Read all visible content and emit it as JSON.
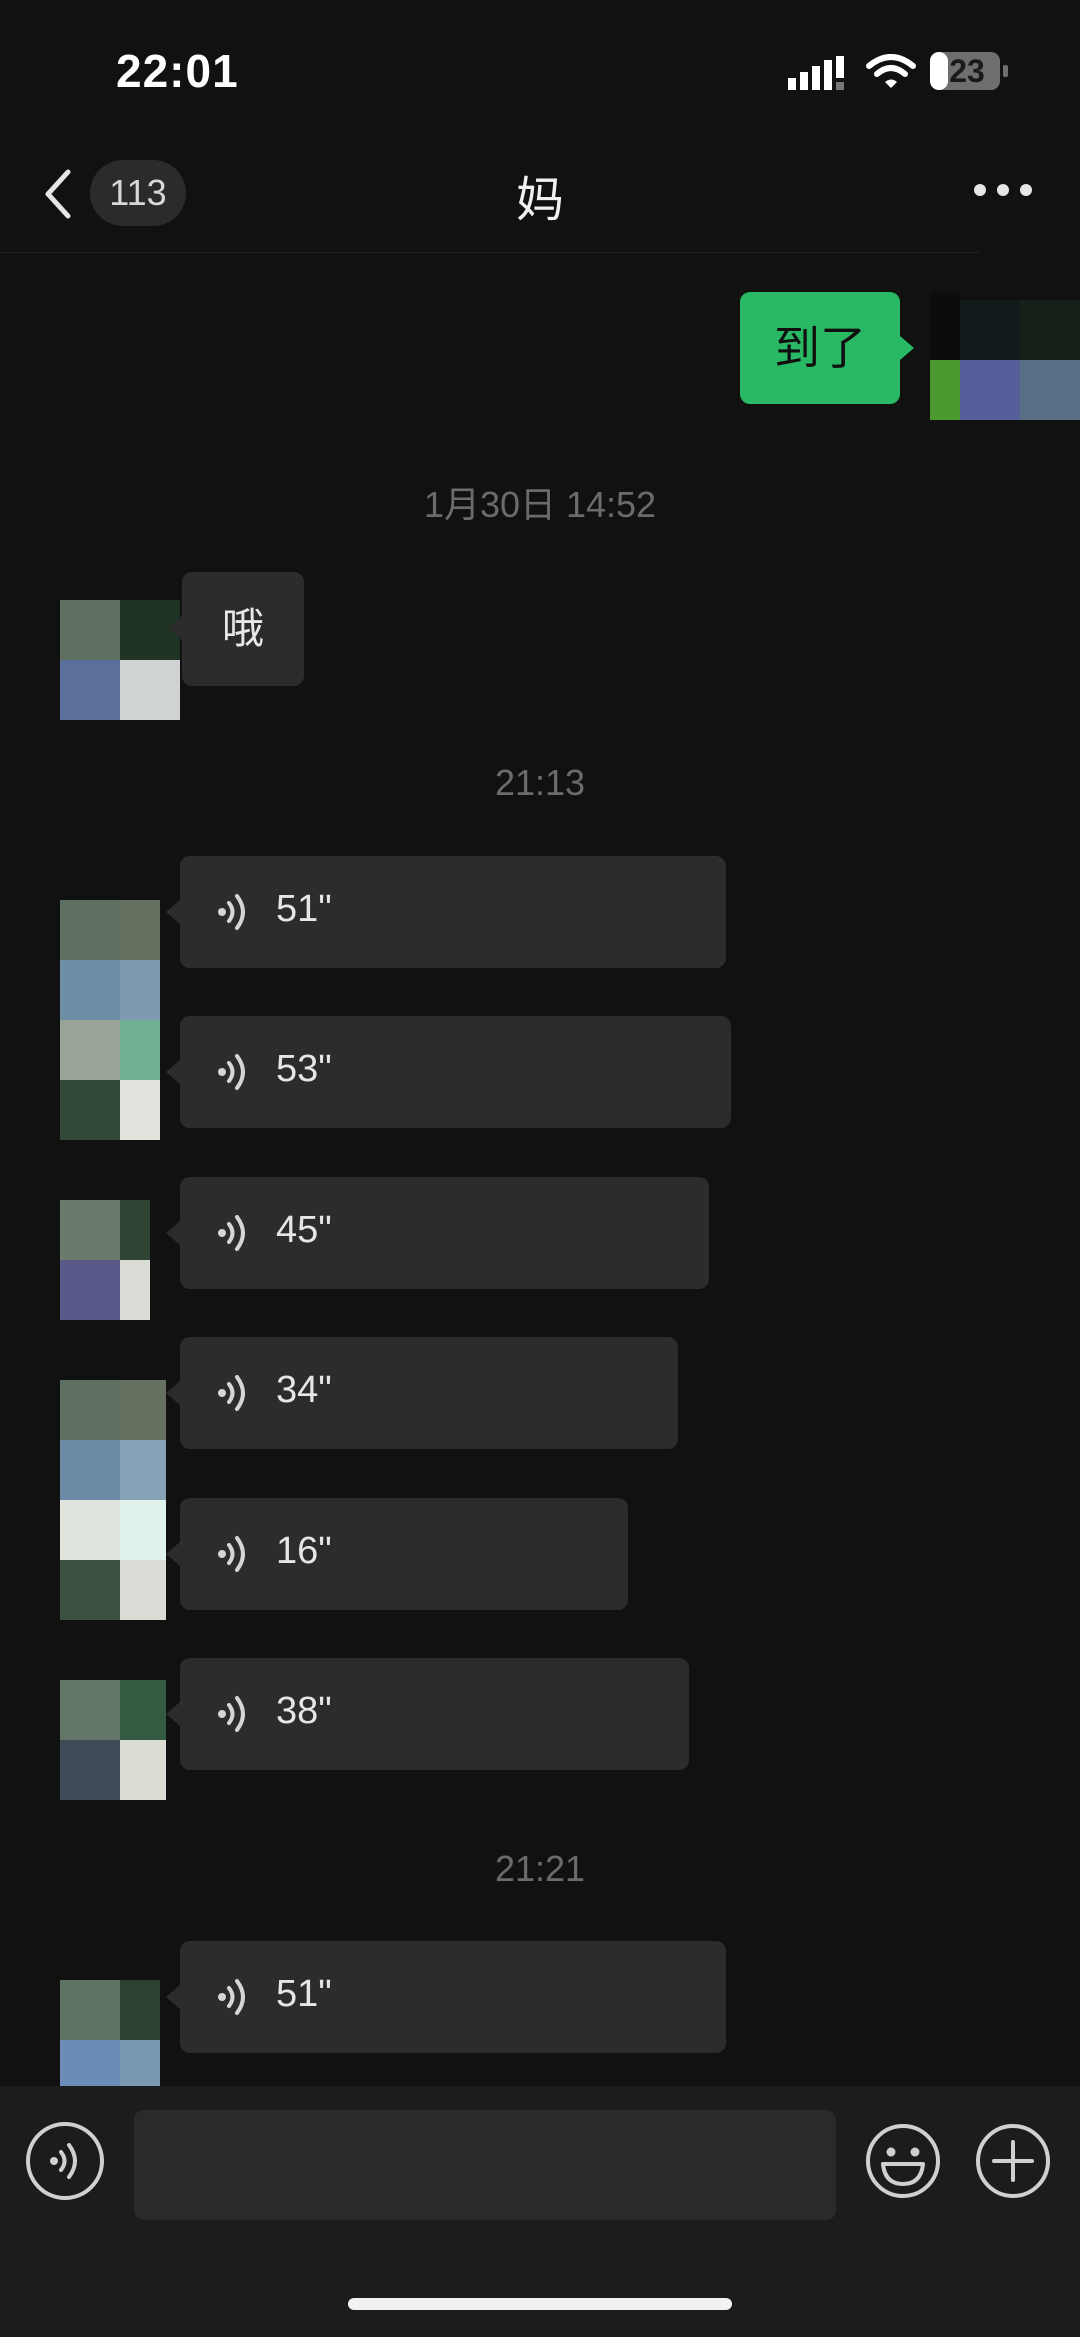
{
  "status_bar": {
    "time": "22:01",
    "battery": "23"
  },
  "header": {
    "unread_count": "113",
    "title": "妈"
  },
  "messages": [
    {
      "type": "text",
      "side": "sent",
      "text": "到了"
    },
    {
      "type": "timestamp",
      "text": "1月30日 14:52"
    },
    {
      "type": "text",
      "side": "received",
      "text": "哦"
    },
    {
      "type": "timestamp",
      "text": "21:13"
    },
    {
      "type": "voice",
      "side": "received",
      "duration": "51\""
    },
    {
      "type": "voice",
      "side": "received",
      "duration": "53\""
    },
    {
      "type": "voice",
      "side": "received",
      "duration": "45\""
    },
    {
      "type": "voice",
      "side": "received",
      "duration": "34\""
    },
    {
      "type": "voice",
      "side": "received",
      "duration": "16\""
    },
    {
      "type": "voice",
      "side": "received",
      "duration": "38\""
    },
    {
      "type": "timestamp",
      "text": "21:21"
    },
    {
      "type": "voice",
      "side": "received",
      "duration": "51\""
    }
  ],
  "input": {
    "placeholder": ""
  },
  "icons": {
    "back": "chevron-left-icon",
    "more": "more-dots-icon",
    "voice": "voice-icon",
    "emoji": "emoji-icon",
    "plus": "plus-icon"
  },
  "colors": {
    "sent_bubble": "#29b864",
    "received_bubble": "#2c2c2c",
    "background": "#111111"
  }
}
